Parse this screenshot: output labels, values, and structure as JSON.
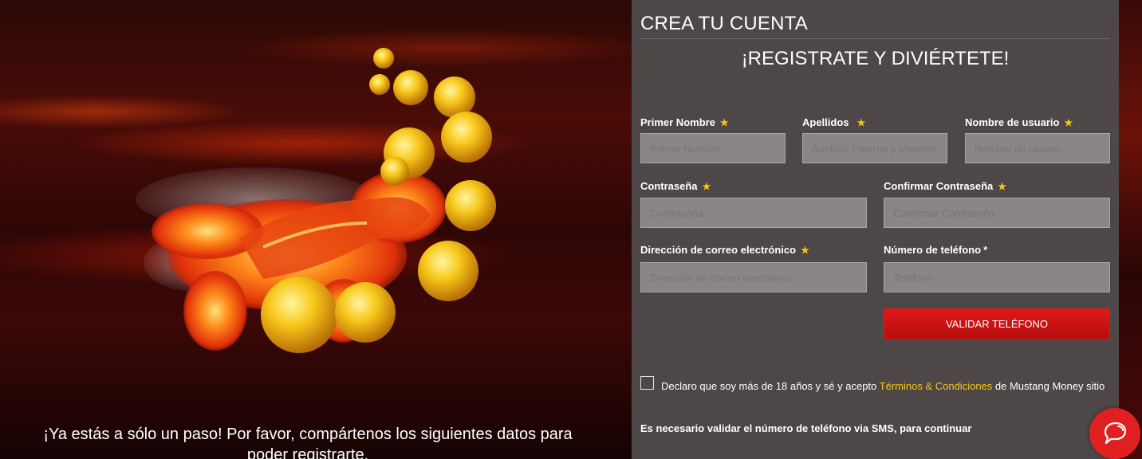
{
  "hero": {
    "caption": "¡Ya estás a sólo un paso! Por favor, compártenos los siguientes datos para poder registrarte."
  },
  "form": {
    "title": "CREA TU CUENTA",
    "subtitle": "¡REGISTRATE Y DIVIÉRTETE!",
    "fields": {
      "first_name": {
        "label": "Primer Nombre",
        "placeholder": "Primer Nombre"
      },
      "last_name": {
        "label": "Apellidos",
        "placeholder": "Apellido Paterno y Materno"
      },
      "username": {
        "label": "Nombre de usuario",
        "placeholder": "Nombre de usuario"
      },
      "password": {
        "label": "Contraseña",
        "placeholder": "Contraseña"
      },
      "confirm_password": {
        "label": "Confirmar Contraseña",
        "placeholder": "Confirmar Contraseña"
      },
      "email": {
        "label": "Dirección de correo electrónico",
        "placeholder": "Dirección de correo electrónico"
      },
      "phone": {
        "label": "Número de teléfono",
        "placeholder": "Teléfono"
      }
    },
    "required_mark": "*",
    "validate_button": "VALIDAR TELÉFONO",
    "terms": {
      "before": "Declaro que soy más de 18 años y sé y acepto ",
      "link": "Términos & Condiciones",
      "after": " de Mustang Money sitio"
    },
    "sms_note": "Es necesario validar el número de teléfono via SMS, para continuar"
  },
  "colors": {
    "accent_red": "#e01818",
    "star_yellow": "#f5c518",
    "panel_bg": "#4d4747"
  },
  "icons": {
    "chat": "chat-bubble-icon"
  }
}
